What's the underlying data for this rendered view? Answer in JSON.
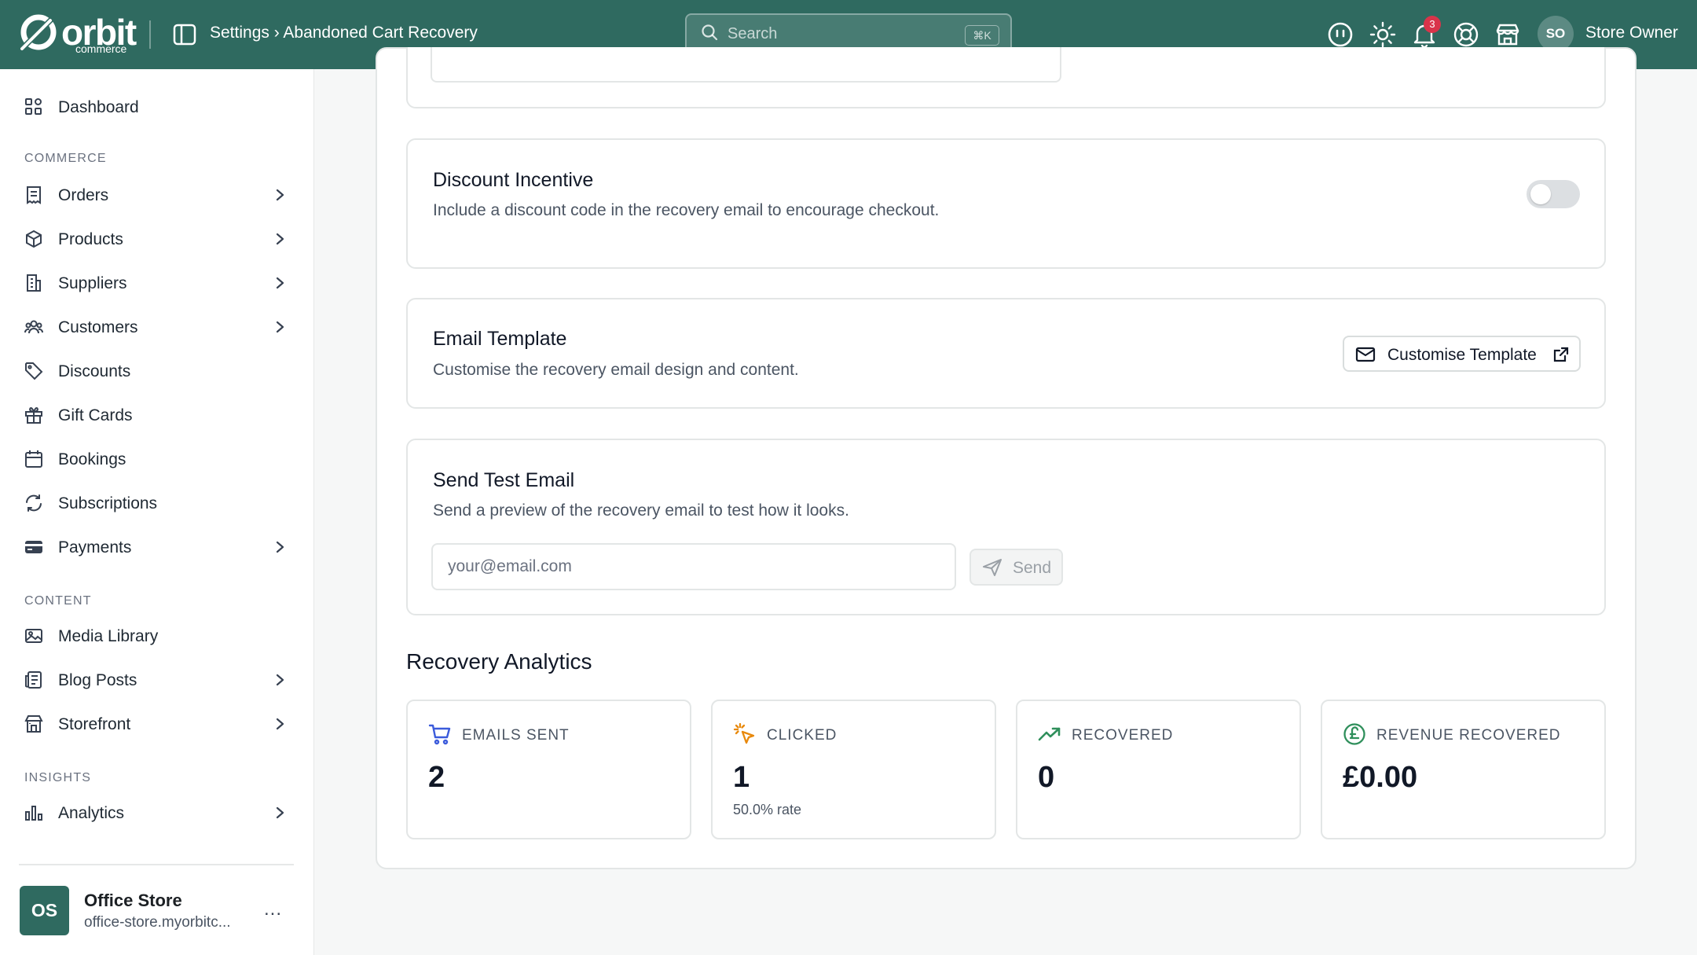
{
  "header": {
    "logo_word": "orbit",
    "logo_sub": "commerce",
    "breadcrumb": "Settings › Abandoned Cart Recovery",
    "search_placeholder": "Search",
    "search_shortcut": "⌘K",
    "notification_count": "3",
    "user_initials": "SO",
    "user_name": "Store Owner",
    "icons": [
      "panel-toggle-icon",
      "search-icon",
      "help-face-icon",
      "sun-icon",
      "bell-icon",
      "lifebuoy-icon",
      "storefront-icon"
    ]
  },
  "sidebar": {
    "dashboard": "Dashboard",
    "section_commerce": "COMMERCE",
    "commerce_items": [
      {
        "label": "Orders",
        "icon": "receipt-icon",
        "chevron": true
      },
      {
        "label": "Products",
        "icon": "box-icon",
        "chevron": true
      },
      {
        "label": "Suppliers",
        "icon": "building-icon",
        "chevron": true
      },
      {
        "label": "Customers",
        "icon": "users-icon",
        "chevron": true
      },
      {
        "label": "Discounts",
        "icon": "tag-icon",
        "chevron": false
      },
      {
        "label": "Gift Cards",
        "icon": "gift-icon",
        "chevron": false
      },
      {
        "label": "Bookings",
        "icon": "calendar-icon",
        "chevron": false
      },
      {
        "label": "Subscriptions",
        "icon": "refresh-icon",
        "chevron": false
      },
      {
        "label": "Payments",
        "icon": "card-icon",
        "chevron": true
      }
    ],
    "section_content": "CONTENT",
    "content_items": [
      {
        "label": "Media Library",
        "icon": "image-icon",
        "chevron": false
      },
      {
        "label": "Blog Posts",
        "icon": "newspaper-icon",
        "chevron": true
      },
      {
        "label": "Storefront",
        "icon": "store-icon",
        "chevron": true
      }
    ],
    "section_insights": "INSIGHTS",
    "insights_items": [
      {
        "label": "Analytics",
        "icon": "bar-chart-icon",
        "chevron": true
      }
    ],
    "store": {
      "initials": "OS",
      "name": "Office Store",
      "url": "office-store.myorbitc...",
      "more": "..."
    }
  },
  "main": {
    "discount": {
      "title": "Discount Incentive",
      "desc": "Include a discount code in the recovery email to encourage checkout.",
      "enabled": false
    },
    "template": {
      "title": "Email Template",
      "desc": "Customise the recovery email design and content.",
      "button": "Customise Template"
    },
    "test_email": {
      "title": "Send Test Email",
      "desc": "Send a preview of the recovery email to test how it looks.",
      "placeholder": "your@email.com",
      "value": "",
      "button": "Send"
    },
    "analytics": {
      "title": "Recovery Analytics",
      "stats": [
        {
          "label": "EMAILS SENT",
          "value": "2",
          "sub": "",
          "icon": "cart-icon",
          "color": "#3b5bdb"
        },
        {
          "label": "CLICKED",
          "value": "1",
          "sub": "50.0% rate",
          "icon": "cursor-click-icon",
          "color": "#e8890c"
        },
        {
          "label": "RECOVERED",
          "value": "0",
          "sub": "",
          "icon": "trending-up-icon",
          "color": "#2f8f5b"
        },
        {
          "label": "REVENUE RECOVERED",
          "value": "£0.00",
          "sub": "",
          "icon": "pound-icon",
          "color": "#2f8f5b"
        }
      ]
    }
  },
  "colors": {
    "header_bg": "#2f6a60",
    "accent": "#2f6a60",
    "badge": "#d9344a"
  }
}
